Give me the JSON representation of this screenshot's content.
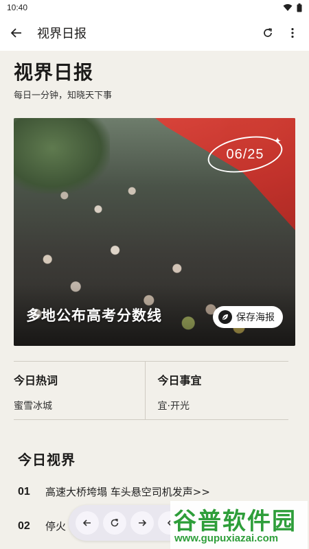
{
  "status_bar": {
    "time": "10:40"
  },
  "app_bar": {
    "title": "视界日报"
  },
  "header": {
    "title": "视界日报",
    "subtitle": "每日一分钟，知晓天下事"
  },
  "hero": {
    "date": "06/25",
    "headline": "多地公布高考分数线",
    "save_label": "保存海报"
  },
  "info": [
    {
      "label": "今日热词",
      "value": "蜜雪冰城"
    },
    {
      "label": "今日事宜",
      "value": "宜·开光"
    }
  ],
  "section": {
    "title": "今日视界"
  },
  "news": [
    {
      "no": "01",
      "text": "高速大桥垮塌 车头悬空司机发声>>"
    },
    {
      "no": "02",
      "text": "停火"
    }
  ],
  "watermark": {
    "main": "谷普软件园",
    "sub": "www.gupuxiazai.com"
  },
  "colors": {
    "background": "#f2f0ea",
    "watermark": "#2e9e3a",
    "canopy": "#e2443a"
  }
}
